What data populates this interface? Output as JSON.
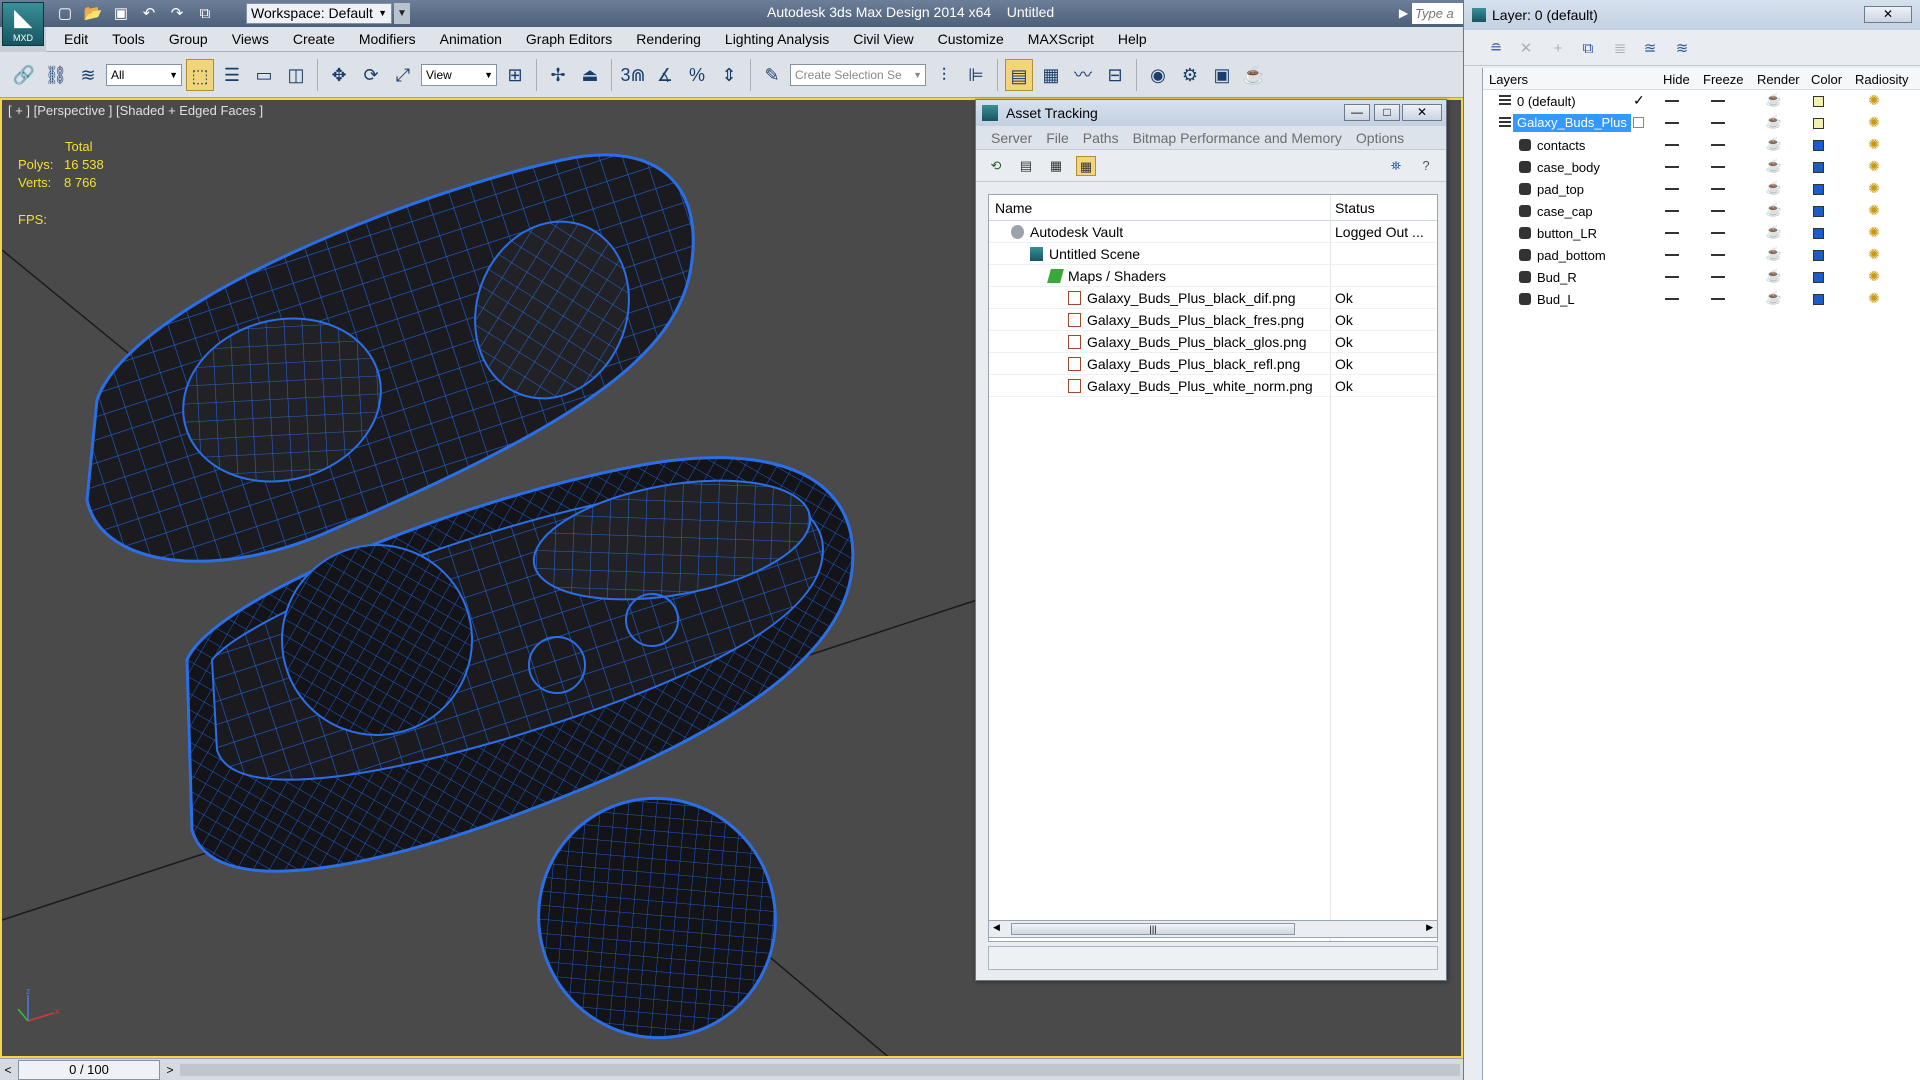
{
  "app": {
    "title": "Autodesk 3ds Max Design 2014 x64",
    "file": "Untitled",
    "logo_label": "MXD",
    "workspace": "Workspace: Default",
    "search_placeholder": "Type a"
  },
  "menus": [
    "Edit",
    "Tools",
    "Group",
    "Views",
    "Create",
    "Modifiers",
    "Animation",
    "Graph Editors",
    "Rendering",
    "Lighting Analysis",
    "Civil View",
    "Customize",
    "MAXScript",
    "Help"
  ],
  "toolbar": {
    "selection_filter": "All",
    "ref_coord": "View",
    "snap_label": "3",
    "named_selection_placeholder": "Create Selection Se"
  },
  "viewport": {
    "label": "[ + ] [Perspective ] [Shaded + Edged Faces ]",
    "stats_header": "Total",
    "polys_label": "Polys:",
    "polys_value": "16 538",
    "verts_label": "Verts:",
    "verts_value": "8 766",
    "fps_label": "FPS:",
    "wire_color": "#1a5fd6"
  },
  "timeline": {
    "position": "0 / 100",
    "left": "<",
    "right": ">"
  },
  "asset_tracking": {
    "title": "Asset Tracking",
    "menus": [
      "Server",
      "File",
      "Paths",
      "Bitmap Performance and Memory",
      "Options"
    ],
    "columns": {
      "name": "Name",
      "status": "Status"
    },
    "rows": [
      {
        "name": "Autodesk Vault",
        "status": "Logged Out ...",
        "level": 0,
        "icon": "vault-icon"
      },
      {
        "name": "Untitled Scene",
        "status": "",
        "level": 1,
        "icon": "scene-icon"
      },
      {
        "name": "Maps / Shaders",
        "status": "",
        "level": 2,
        "icon": "maps-icon"
      },
      {
        "name": "Galaxy_Buds_Plus_black_dif.png",
        "status": "Ok",
        "level": 3,
        "icon": "bitmap-icon"
      },
      {
        "name": "Galaxy_Buds_Plus_black_fres.png",
        "status": "Ok",
        "level": 3,
        "icon": "bitmap-icon"
      },
      {
        "name": "Galaxy_Buds_Plus_black_glos.png",
        "status": "Ok",
        "level": 3,
        "icon": "bitmap-icon"
      },
      {
        "name": "Galaxy_Buds_Plus_black_refl.png",
        "status": "Ok",
        "level": 3,
        "icon": "bitmap-icon"
      },
      {
        "name": "Galaxy_Buds_Plus_white_norm.png",
        "status": "Ok",
        "level": 3,
        "icon": "bitmap-icon"
      }
    ]
  },
  "layer_panel": {
    "title": "Layer: 0 (default)",
    "columns": {
      "layers": "Layers",
      "hide": "Hide",
      "freeze": "Freeze",
      "render": "Render",
      "color": "Color",
      "radiosity": "Radiosity"
    },
    "rows": [
      {
        "name": "0 (default)",
        "level": 0,
        "type": "layer",
        "current": true,
        "color": "#f3f0b0"
      },
      {
        "name": "Galaxy_Buds_Plus",
        "level": 0,
        "type": "layer",
        "selected": true,
        "color": "#f3f0b0"
      },
      {
        "name": "contacts",
        "level": 1,
        "type": "object",
        "color": "#1c5bc8"
      },
      {
        "name": "case_body",
        "level": 1,
        "type": "object",
        "color": "#1c5bc8"
      },
      {
        "name": "pad_top",
        "level": 1,
        "type": "object",
        "color": "#1c5bc8"
      },
      {
        "name": "case_cap",
        "level": 1,
        "type": "object",
        "color": "#1c5bc8"
      },
      {
        "name": "button_LR",
        "level": 1,
        "type": "object",
        "color": "#1c5bc8"
      },
      {
        "name": "pad_bottom",
        "level": 1,
        "type": "object",
        "color": "#1c5bc8"
      },
      {
        "name": "Bud_R",
        "level": 1,
        "type": "object",
        "color": "#1c5bc8"
      },
      {
        "name": "Bud_L",
        "level": 1,
        "type": "object",
        "color": "#1c5bc8"
      }
    ]
  },
  "colors": {
    "viewport_border": "#f2d54a",
    "stats_text": "#f5df32",
    "selection": "#3399ff"
  }
}
